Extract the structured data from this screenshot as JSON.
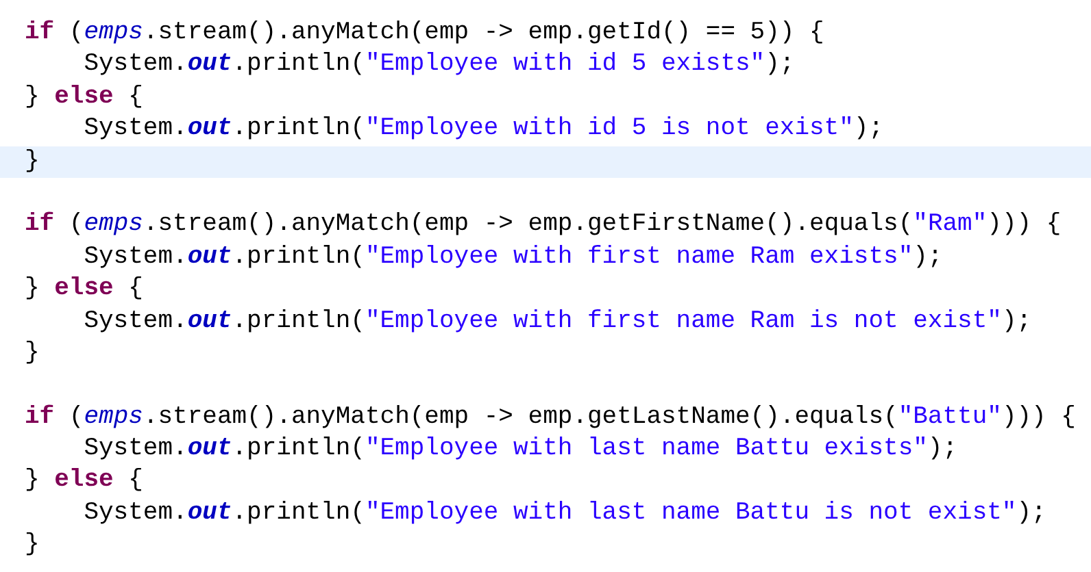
{
  "editor": {
    "lines": [
      {
        "current": false,
        "tokens": [
          {
            "kind": "keyword",
            "text": "if"
          },
          {
            "kind": "plain",
            "text": " ("
          },
          {
            "kind": "field",
            "text": "emps"
          },
          {
            "kind": "plain",
            "text": ".stream().anyMatch(emp -> emp.getId() == 5)) {"
          }
        ]
      },
      {
        "current": false,
        "tokens": [
          {
            "kind": "plain",
            "text": "    System."
          },
          {
            "kind": "static-field",
            "text": "out"
          },
          {
            "kind": "plain",
            "text": ".println("
          },
          {
            "kind": "string",
            "text": "\"Employee with id 5 exists\""
          },
          {
            "kind": "plain",
            "text": ");"
          }
        ]
      },
      {
        "current": false,
        "tokens": [
          {
            "kind": "plain",
            "text": "} "
          },
          {
            "kind": "keyword",
            "text": "else"
          },
          {
            "kind": "plain",
            "text": " {"
          }
        ]
      },
      {
        "current": false,
        "tokens": [
          {
            "kind": "plain",
            "text": "    System."
          },
          {
            "kind": "static-field",
            "text": "out"
          },
          {
            "kind": "plain",
            "text": ".println("
          },
          {
            "kind": "string",
            "text": "\"Employee with id 5 is not exist\""
          },
          {
            "kind": "plain",
            "text": ");"
          }
        ]
      },
      {
        "current": true,
        "tokens": [
          {
            "kind": "plain",
            "text": "}"
          }
        ]
      },
      {
        "current": false
      },
      {
        "current": false,
        "tokens": [
          {
            "kind": "keyword",
            "text": "if"
          },
          {
            "kind": "plain",
            "text": " ("
          },
          {
            "kind": "field",
            "text": "emps"
          },
          {
            "kind": "plain",
            "text": ".stream().anyMatch(emp -> emp.getFirstName().equals("
          },
          {
            "kind": "string",
            "text": "\"Ram\""
          },
          {
            "kind": "plain",
            "text": "))) {"
          }
        ]
      },
      {
        "current": false,
        "tokens": [
          {
            "kind": "plain",
            "text": "    System."
          },
          {
            "kind": "static-field",
            "text": "out"
          },
          {
            "kind": "plain",
            "text": ".println("
          },
          {
            "kind": "string",
            "text": "\"Employee with first name Ram exists\""
          },
          {
            "kind": "plain",
            "text": ");"
          }
        ]
      },
      {
        "current": false,
        "tokens": [
          {
            "kind": "plain",
            "text": "} "
          },
          {
            "kind": "keyword",
            "text": "else"
          },
          {
            "kind": "plain",
            "text": " {"
          }
        ]
      },
      {
        "current": false,
        "tokens": [
          {
            "kind": "plain",
            "text": "    System."
          },
          {
            "kind": "static-field",
            "text": "out"
          },
          {
            "kind": "plain",
            "text": ".println("
          },
          {
            "kind": "string",
            "text": "\"Employee with first name Ram is not exist\""
          },
          {
            "kind": "plain",
            "text": ");"
          }
        ]
      },
      {
        "current": false,
        "tokens": [
          {
            "kind": "plain",
            "text": "}"
          }
        ]
      },
      {
        "current": false
      },
      {
        "current": false,
        "tokens": [
          {
            "kind": "keyword",
            "text": "if"
          },
          {
            "kind": "plain",
            "text": " ("
          },
          {
            "kind": "field",
            "text": "emps"
          },
          {
            "kind": "plain",
            "text": ".stream().anyMatch(emp -> emp.getLastName().equals("
          },
          {
            "kind": "string",
            "text": "\"Battu\""
          },
          {
            "kind": "plain",
            "text": "))) {"
          }
        ]
      },
      {
        "current": false,
        "tokens": [
          {
            "kind": "plain",
            "text": "    System."
          },
          {
            "kind": "static-field",
            "text": "out"
          },
          {
            "kind": "plain",
            "text": ".println("
          },
          {
            "kind": "string",
            "text": "\"Employee with last name Battu exists\""
          },
          {
            "kind": "plain",
            "text": ");"
          }
        ]
      },
      {
        "current": false,
        "tokens": [
          {
            "kind": "plain",
            "text": "} "
          },
          {
            "kind": "keyword",
            "text": "else"
          },
          {
            "kind": "plain",
            "text": " {"
          }
        ]
      },
      {
        "current": false,
        "tokens": [
          {
            "kind": "plain",
            "text": "    System."
          },
          {
            "kind": "static-field",
            "text": "out"
          },
          {
            "kind": "plain",
            "text": ".println("
          },
          {
            "kind": "string",
            "text": "\"Employee with last name Battu is not exist\""
          },
          {
            "kind": "plain",
            "text": ");"
          }
        ]
      },
      {
        "current": false,
        "tokens": [
          {
            "kind": "plain",
            "text": "}"
          }
        ]
      }
    ]
  }
}
